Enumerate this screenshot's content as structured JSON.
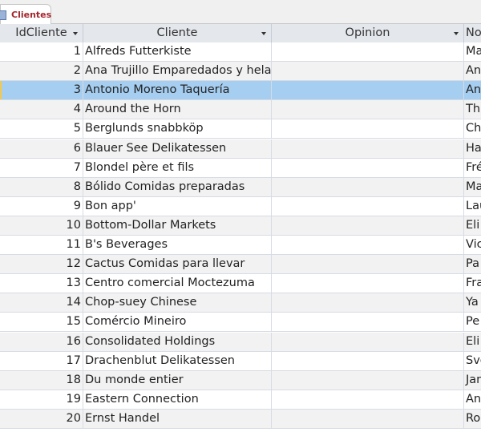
{
  "tab": {
    "label": "Clientes",
    "icon": "table-icon"
  },
  "columns": [
    "IdCliente",
    "Cliente",
    "Opinion",
    "No"
  ],
  "selected_row": 3,
  "rows": [
    {
      "id": "1",
      "cliente": "Alfreds Futterkiste",
      "opinion": "",
      "contacto": "Ma"
    },
    {
      "id": "2",
      "cliente": "Ana Trujillo Emparedados y helados",
      "opinion": "",
      "contacto": "An"
    },
    {
      "id": "3",
      "cliente": "Antonio Moreno Taquería",
      "opinion": "",
      "contacto": "An"
    },
    {
      "id": "4",
      "cliente": "Around the Horn",
      "opinion": "",
      "contacto": "Th"
    },
    {
      "id": "5",
      "cliente": "Berglunds snabbköp",
      "opinion": "",
      "contacto": "Ch"
    },
    {
      "id": "6",
      "cliente": "Blauer See Delikatessen",
      "opinion": "",
      "contacto": "Ha"
    },
    {
      "id": "7",
      "cliente": "Blondel père et fils",
      "opinion": "",
      "contacto": "Fré"
    },
    {
      "id": "8",
      "cliente": "Bólido Comidas preparadas",
      "opinion": "",
      "contacto": "Ma"
    },
    {
      "id": "9",
      "cliente": "Bon app'",
      "opinion": "",
      "contacto": "Lau"
    },
    {
      "id": "10",
      "cliente": "Bottom-Dollar Markets",
      "opinion": "",
      "contacto": "Eli"
    },
    {
      "id": "11",
      "cliente": "B's Beverages",
      "opinion": "",
      "contacto": "Vic"
    },
    {
      "id": "12",
      "cliente": "Cactus Comidas para llevar",
      "opinion": "",
      "contacto": "Pa"
    },
    {
      "id": "13",
      "cliente": "Centro comercial Moctezuma",
      "opinion": "",
      "contacto": "Fra"
    },
    {
      "id": "14",
      "cliente": "Chop-suey Chinese",
      "opinion": "",
      "contacto": "Ya"
    },
    {
      "id": "15",
      "cliente": "Comércio Mineiro",
      "opinion": "",
      "contacto": "Pe"
    },
    {
      "id": "16",
      "cliente": "Consolidated Holdings",
      "opinion": "",
      "contacto": "Eli"
    },
    {
      "id": "17",
      "cliente": "Drachenblut Delikatessen",
      "opinion": "",
      "contacto": "Sve"
    },
    {
      "id": "18",
      "cliente": "Du monde entier",
      "opinion": "",
      "contacto": "Jan"
    },
    {
      "id": "19",
      "cliente": "Eastern Connection",
      "opinion": "",
      "contacto": "An"
    },
    {
      "id": "20",
      "cliente": "Ernst Handel",
      "opinion": "",
      "contacto": "Ro"
    }
  ]
}
